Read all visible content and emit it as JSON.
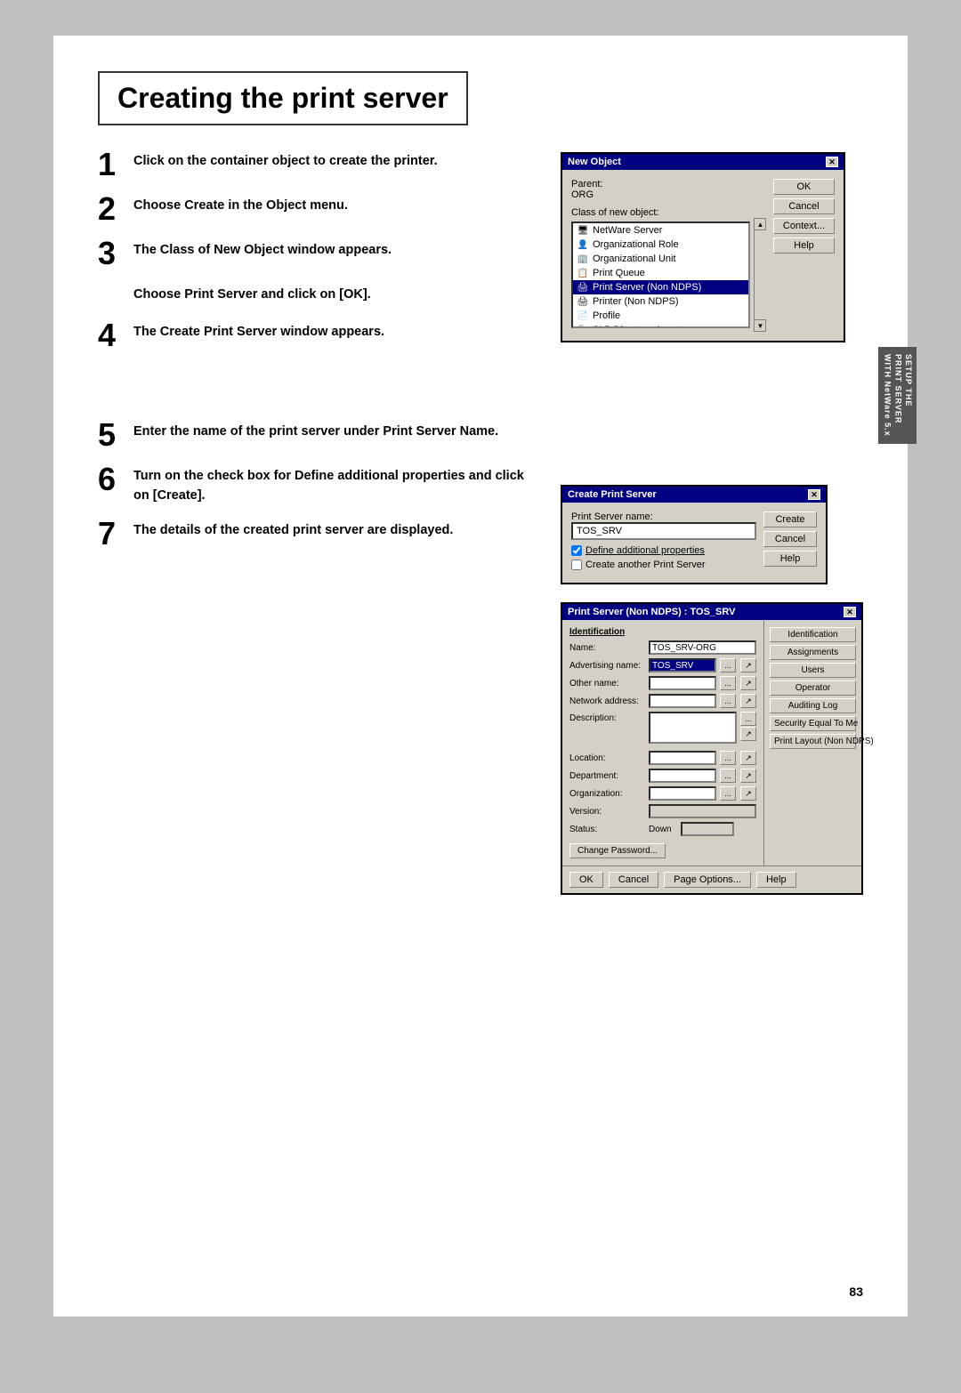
{
  "page": {
    "title": "Creating the print server",
    "page_number": "83",
    "background_color": "#c0c0c0"
  },
  "steps": [
    {
      "number": "1",
      "text": "Click on the container object to create the printer."
    },
    {
      "number": "2",
      "text": "Choose Create in the Object menu."
    },
    {
      "number": "3",
      "text": "The Class of New Object window appears.",
      "sub": "Choose Print Server and click on [OK]."
    },
    {
      "number": "4",
      "text": "The Create Print Server window appears."
    },
    {
      "number": "5",
      "text": "Enter the name of the print server under Print Server Name."
    },
    {
      "number": "6",
      "text": "Turn on the check box for Define additional properties and click on [Create]."
    },
    {
      "number": "7",
      "text": "The details of the created print server are displayed."
    }
  ],
  "new_object_dialog": {
    "title": "New Object",
    "parent_label": "Parent:",
    "parent_value": "ORG",
    "class_label": "Class of new object:",
    "list_items": [
      {
        "label": "NetWare Server",
        "icon": "server"
      },
      {
        "label": "Organizational Role",
        "icon": "role"
      },
      {
        "label": "Organizational Unit",
        "icon": "ou"
      },
      {
        "label": "Print Queue",
        "icon": "queue"
      },
      {
        "label": "Print Server (Non NDPS)",
        "icon": "printserver",
        "selected": true
      },
      {
        "label": "Printer (Non NDPS)",
        "icon": "printer"
      },
      {
        "label": "Profile",
        "icon": "profile"
      },
      {
        "label": "SLP Directory Agent",
        "icon": "slp"
      }
    ],
    "buttons": [
      "OK",
      "Cancel",
      "Context...",
      "Help"
    ]
  },
  "create_ps_dialog": {
    "title": "Create Print Server",
    "name_label": "Print Server name:",
    "name_value": "TOS_SRV",
    "checkbox1_label": "Define additional properties",
    "checkbox1_checked": true,
    "checkbox2_label": "Create another Print Server",
    "checkbox2_checked": false,
    "buttons": [
      "Create",
      "Cancel",
      "Help"
    ]
  },
  "props_dialog": {
    "title": "Print Server (Non NDPS) : TOS_SRV",
    "section": "Identification",
    "fields": [
      {
        "label": "Name:",
        "value": "TOS_SRV-ORG",
        "type": "text"
      },
      {
        "label": "Advertising name:",
        "value": "TOS_SRV",
        "type": "selected"
      },
      {
        "label": "Other name:",
        "value": "",
        "type": "text"
      },
      {
        "label": "Network address:",
        "value": "",
        "type": "text"
      },
      {
        "label": "Description:",
        "value": "",
        "type": "textarea"
      },
      {
        "label": "Location:",
        "value": "",
        "type": "text"
      },
      {
        "label": "Department:",
        "value": "",
        "type": "text"
      },
      {
        "label": "Organization:",
        "value": "",
        "type": "text"
      },
      {
        "label": "Version:",
        "value": "",
        "type": "text"
      },
      {
        "label": "Status:",
        "value": "Down",
        "type": "status"
      }
    ],
    "right_buttons": [
      "Identification",
      "Assignments",
      "Users",
      "Operator",
      "Auditing Log",
      "Security Equal To Me",
      "Print Layout (Non NDPS)"
    ],
    "bottom_buttons": [
      "OK",
      "Cancel",
      "Page Options...",
      "Help"
    ],
    "change_password_btn": "Change Password..."
  },
  "sidebar": {
    "label1": "SETUP THE",
    "label2": "PRINT SERVER",
    "label3": "WITH NetWare 5.x"
  }
}
